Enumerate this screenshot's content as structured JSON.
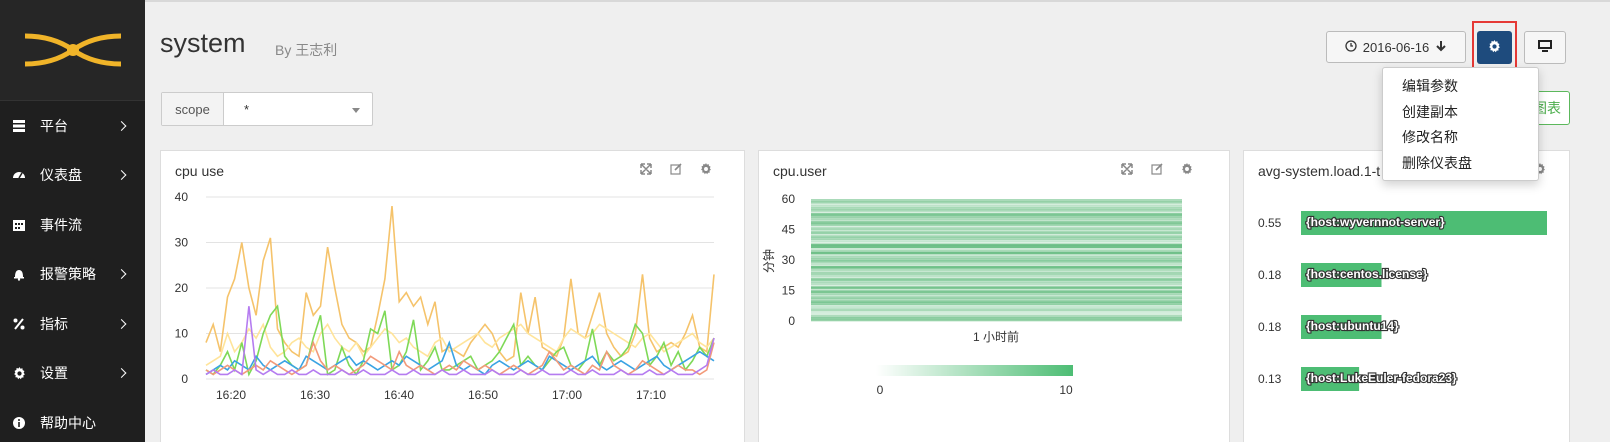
{
  "sidebar": {
    "logo_icon": "eye-logo-icon",
    "items": [
      {
        "label": "平台",
        "icon": "server-icon",
        "has_chevron": true
      },
      {
        "label": "仪表盘",
        "icon": "dashboard-icon",
        "has_chevron": true
      },
      {
        "label": "事件流",
        "icon": "calendar-icon",
        "has_chevron": false
      },
      {
        "label": "报警策略",
        "icon": "bell-icon",
        "has_chevron": true
      },
      {
        "label": "指标",
        "icon": "percent-icon",
        "has_chevron": true
      },
      {
        "label": "设置",
        "icon": "gear-icon",
        "has_chevron": true
      },
      {
        "label": "帮助中心",
        "icon": "info-icon",
        "has_chevron": false
      }
    ]
  },
  "header": {
    "title": "system",
    "subtitle": "By 王志利",
    "date": "2016-06-16",
    "green_button": "控图表"
  },
  "scope": {
    "label": "scope",
    "value": "*"
  },
  "dropdown": {
    "items": [
      "编辑参数",
      "创建副本",
      "修改名称",
      "删除仪表盘"
    ]
  },
  "colors": {
    "gear_button": "#1e4b7d",
    "highlight_border": "#e53935",
    "bar": "#4dbd74",
    "green_button": "#5cb85c"
  },
  "panels": [
    {
      "title": "cpu use"
    },
    {
      "title": "cpu.user"
    },
    {
      "title": "avg-system.load.1-t"
    }
  ],
  "chart_data": [
    {
      "type": "line",
      "title": "cpu use",
      "x_ticks": [
        "16:20",
        "16:30",
        "16:40",
        "16:50",
        "17:00",
        "17:10"
      ],
      "ylim": [
        0,
        40
      ],
      "y_ticks": [
        0,
        10,
        20,
        30,
        40
      ],
      "grid": true,
      "series": [
        {
          "color": "#f5c36b",
          "values": [
            8,
            12,
            6,
            18,
            22,
            30,
            20,
            14,
            26,
            31,
            11,
            8,
            6,
            5,
            19,
            14,
            16,
            29,
            20,
            12,
            9,
            8,
            6,
            7,
            14,
            22,
            38,
            17,
            19,
            16,
            18,
            12,
            17,
            6,
            7,
            6,
            5,
            8,
            10,
            12,
            10,
            6,
            4,
            5,
            19,
            10,
            18,
            7,
            6,
            5,
            9,
            22,
            10,
            9,
            14,
            19,
            10,
            7,
            5,
            6,
            10,
            23,
            9,
            6,
            7,
            8,
            7,
            10,
            14,
            7,
            6,
            23
          ]
        },
        {
          "color": "#ffe49a",
          "values": [
            3,
            4,
            5,
            10,
            6,
            8,
            11,
            9,
            12,
            7,
            5,
            6,
            8,
            9,
            7,
            6,
            10,
            12,
            9,
            7,
            6,
            8,
            5,
            7,
            9,
            11,
            10,
            8,
            9,
            7,
            6,
            5,
            8,
            9,
            6,
            7,
            8,
            9,
            10,
            8,
            7,
            9,
            10,
            11,
            12,
            10,
            9,
            8,
            7,
            6,
            9,
            11,
            10,
            9,
            10,
            12,
            11,
            10,
            9,
            8,
            7,
            9,
            10,
            8,
            6,
            7,
            8,
            9,
            10,
            8,
            7,
            9
          ]
        },
        {
          "color": "#7ed957",
          "values": [
            2,
            1,
            3,
            6,
            2,
            8,
            1,
            4,
            10,
            14,
            16,
            5,
            3,
            2,
            3,
            9,
            14,
            1,
            2,
            7,
            3,
            1,
            4,
            11,
            10,
            15,
            2,
            3,
            6,
            13,
            2,
            4,
            7,
            2,
            2,
            3,
            4,
            5,
            2,
            3,
            4,
            6,
            9,
            12,
            3,
            5,
            3,
            2,
            4,
            6,
            7,
            3,
            2,
            4,
            11,
            3,
            6,
            4,
            5,
            7,
            12,
            10,
            3,
            5,
            8,
            3,
            6,
            2,
            4,
            7,
            5,
            9
          ]
        },
        {
          "color": "#3aa3e3",
          "values": [
            1,
            2,
            3,
            2,
            4,
            3,
            2,
            5,
            3,
            2,
            3,
            4,
            3,
            2,
            5,
            4,
            3,
            2,
            3,
            4,
            5,
            3,
            4,
            3,
            2,
            3,
            4,
            3,
            5,
            4,
            3,
            2,
            3,
            4,
            8,
            3,
            2,
            3,
            2,
            1,
            3,
            4,
            3,
            2,
            3,
            4,
            3,
            2,
            5,
            4,
            3,
            2,
            3,
            4,
            5,
            3,
            2,
            3,
            4,
            3,
            2,
            3,
            4,
            5,
            3,
            2,
            3,
            4,
            5,
            6,
            5,
            4
          ]
        },
        {
          "color": "#f29a7a",
          "values": [
            2,
            1,
            2,
            3,
            2,
            1,
            2,
            3,
            2,
            4,
            3,
            2,
            1,
            2,
            3,
            8,
            4,
            2,
            3,
            2,
            1,
            2,
            3,
            5,
            4,
            3,
            2,
            6,
            3,
            2,
            3,
            2,
            1,
            2,
            3,
            2,
            4,
            3,
            2,
            3,
            2,
            1,
            2,
            3,
            2,
            1,
            2,
            3,
            6,
            4,
            2,
            3,
            2,
            1,
            3,
            2,
            6,
            3,
            2,
            1,
            2,
            4,
            3,
            2,
            1,
            2,
            3,
            2,
            2,
            1,
            2,
            8
          ]
        },
        {
          "color": "#b57cf0",
          "values": [
            1,
            2,
            1,
            1,
            2,
            1,
            16,
            2,
            1,
            2,
            1,
            1,
            2,
            1,
            1,
            2,
            1,
            1,
            1,
            2,
            1,
            1,
            2,
            1,
            1,
            1,
            2,
            1,
            1,
            2,
            1,
            1,
            1,
            2,
            1,
            1,
            2,
            1,
            1,
            1,
            2,
            1,
            1,
            1,
            2,
            1,
            1,
            2,
            1,
            1,
            1,
            2,
            1,
            1,
            2,
            1,
            1,
            1,
            2,
            1,
            1,
            1,
            2,
            1,
            1,
            2,
            1,
            1,
            1,
            2,
            3,
            9
          ]
        }
      ]
    },
    {
      "type": "heatmap",
      "title": "cpu.user",
      "ylabel": "分钟",
      "y_ticks": [
        0,
        15,
        30,
        45,
        60
      ],
      "x_label": "1 小时前",
      "scale_min": 0,
      "scale_max": 10
    },
    {
      "type": "bar",
      "title": "avg-system.load.1-t",
      "categories": [
        "{host:wyvernnot-server}",
        "{host:centos.license}",
        "{host:ubuntu14}",
        "{host:LukeEuler-fedora23}"
      ],
      "values": [
        0.55,
        0.18,
        0.18,
        0.13
      ]
    }
  ]
}
